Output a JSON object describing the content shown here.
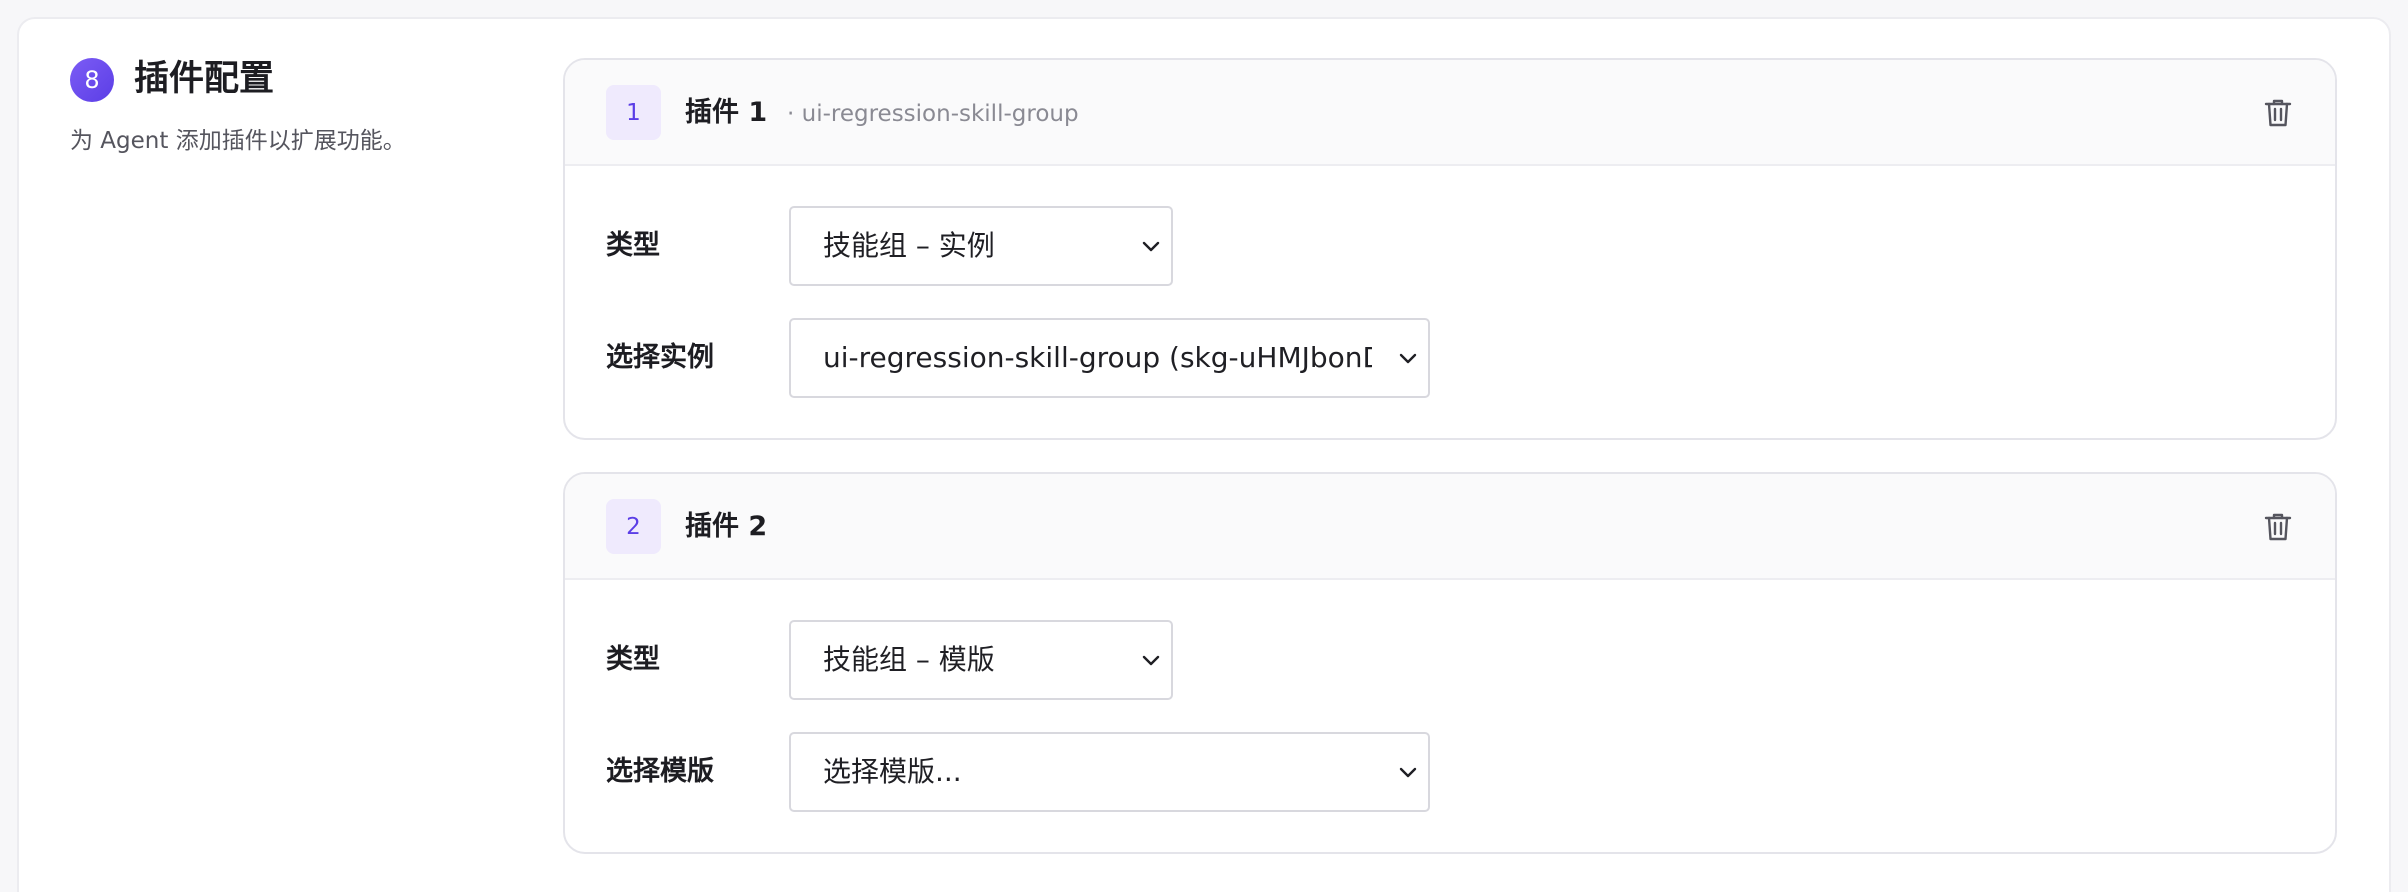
{
  "section": {
    "step": "8",
    "title": "插件配置",
    "description": "为 Agent 添加插件以扩展功能。"
  },
  "plugins": [
    {
      "index": "1",
      "name": "插件 1",
      "subtitle": "· ui-regression-skill-group",
      "fields": [
        {
          "label": "类型",
          "value": "技能组 – 实例"
        },
        {
          "label": "选择实例",
          "value": "ui-regression-skill-group (skg-uHMJbonD"
        }
      ]
    },
    {
      "index": "2",
      "name": "插件 2",
      "subtitle": "",
      "fields": [
        {
          "label": "类型",
          "value": "技能组 – 模版"
        },
        {
          "label": "选择模版",
          "value": "选择模版..."
        }
      ]
    }
  ],
  "icons": {
    "delete": "trash-icon",
    "dropdown": "chevron-down-icon"
  },
  "colors": {
    "accent": "#5b3ee6",
    "badge_bg": "#efeafd"
  }
}
